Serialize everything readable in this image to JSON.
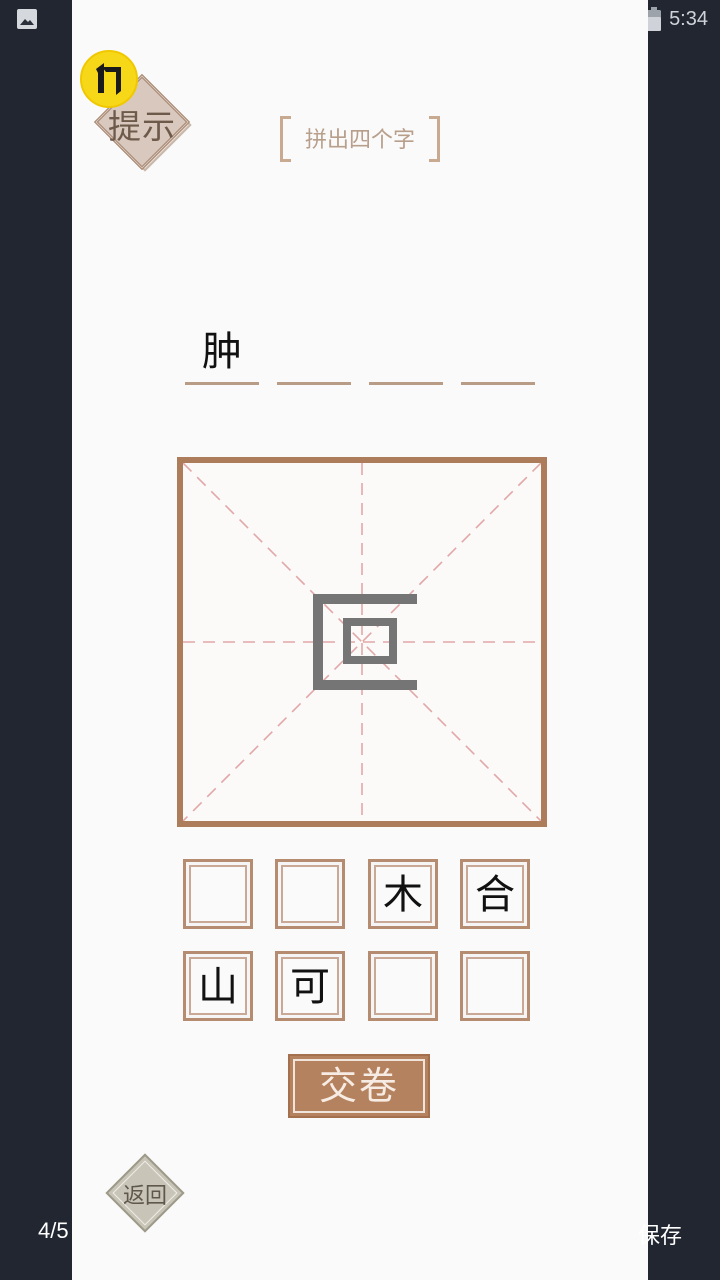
{
  "status_bar": {
    "time": "5:34",
    "icons": [
      "gallery-icon",
      "wifi-icon",
      "no-sim-icon",
      "battery-icon"
    ]
  },
  "hint": {
    "label": "提示",
    "badge_icon": "flash-icon"
  },
  "title": {
    "text": "拼出四个字"
  },
  "answer_slots": [
    "肿",
    "",
    "",
    ""
  ],
  "current_glyph": {
    "icon": "radical-匚-glyph"
  },
  "tiles": [
    {
      "text": ""
    },
    {
      "text": ""
    },
    {
      "text": "木"
    },
    {
      "text": "合"
    },
    {
      "text": "山"
    },
    {
      "text": "可"
    },
    {
      "text": ""
    },
    {
      "text": ""
    }
  ],
  "submit_label": "交卷",
  "back_label": "返回",
  "overlay": {
    "page_counter": "4/5",
    "save_label": "保存"
  },
  "colors": {
    "accent_brown": "#ad7c5b",
    "grid_guide_pink": "#e2a7a7",
    "badge_yellow": "#f7d818"
  }
}
